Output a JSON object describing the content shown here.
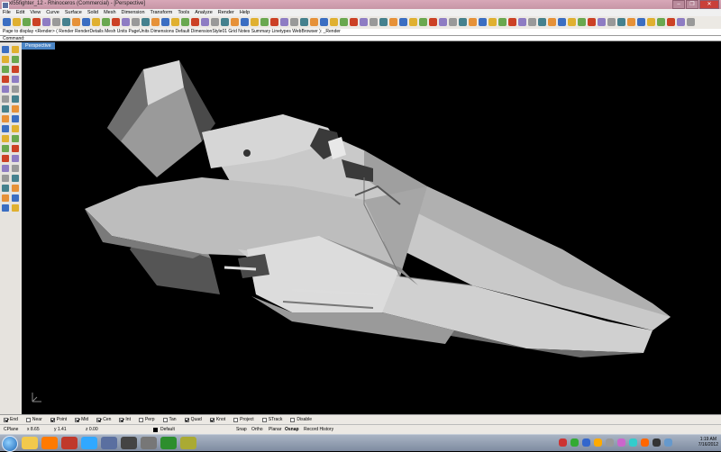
{
  "window": {
    "title": "xl55fighter_12 - Rhinoceros (Commercial) - [Perspective]",
    "buttons": [
      "–",
      "❐",
      "✕"
    ]
  },
  "menu": [
    "File",
    "Edit",
    "View",
    "Curve",
    "Surface",
    "Solid",
    "Mesh",
    "Dimension",
    "Transform",
    "Tools",
    "Analyze",
    "Render",
    "Help"
  ],
  "history": "Page to display <Render> ( Render  RenderDetails  Mesh  Units  PageUnits  Dimensions  Default  DimensionStyle01  Grid  Notes  Summary  Linetypes  WebBrowser ): _Render",
  "command_prompt": "Command:",
  "viewport": {
    "label": "Perspective",
    "background": "#000000"
  },
  "osnaps": [
    {
      "label": "End",
      "checked": true
    },
    {
      "label": "Near",
      "checked": false
    },
    {
      "label": "Point",
      "checked": true
    },
    {
      "label": "Mid",
      "checked": true
    },
    {
      "label": "Cen",
      "checked": true
    },
    {
      "label": "Int",
      "checked": true
    },
    {
      "label": "Perp",
      "checked": false
    },
    {
      "label": "Tan",
      "checked": false
    },
    {
      "label": "Quad",
      "checked": true
    },
    {
      "label": "Knot",
      "checked": true
    },
    {
      "label": "Project",
      "checked": false
    },
    {
      "label": "STrack",
      "checked": false
    },
    {
      "label": "Disable",
      "checked": false
    }
  ],
  "status": {
    "cplane": "CPlane",
    "x": "x 8.65",
    "y": "y 1.41",
    "z": "z 0.00",
    "layer": "Default",
    "snap": "Snap",
    "ortho": "Ortho",
    "planar": "Planar",
    "osnap": "Osnap",
    "record_history": "Record History"
  },
  "taskbar": {
    "time": "1:19 AM",
    "date": "7/16/2012",
    "apps": [
      "start",
      "firefox",
      "explorer",
      "media",
      "paint",
      "photoshop",
      "app",
      "zbrush",
      "app2",
      "app3"
    ]
  },
  "colors": {
    "title_bar": "#d8a8b8",
    "viewport_tab": "#4a84c4",
    "model_light": "#c8c8c8",
    "model_dark": "#5a5a5a"
  }
}
